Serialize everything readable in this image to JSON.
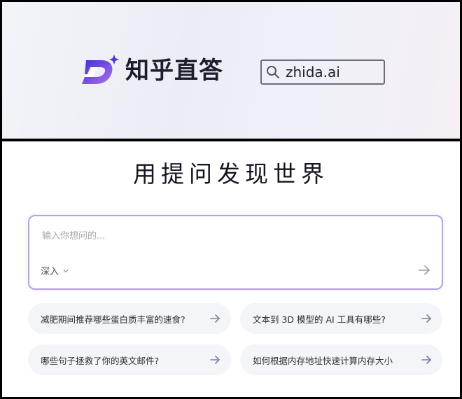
{
  "banner": {
    "brand_name": "知乎直答",
    "domain": "zhida.ai"
  },
  "hero": {
    "title": "用提问发现世界"
  },
  "ask": {
    "placeholder": "输入你想问的...",
    "mode_label": "深入"
  },
  "suggestions": [
    {
      "text": "减肥期间推荐哪些蛋白质丰富的速食?"
    },
    {
      "text": "文本到 3D 模型的 AI 工具有哪些?"
    },
    {
      "text": "哪些句子拯救了你的英文邮件?"
    },
    {
      "text": "如何根据内存地址快速计算内存大小"
    }
  ],
  "icons": {
    "logo": "zhida-logo-icon",
    "sparkle": "sparkle-icon",
    "search": "search-icon",
    "chevron": "chevron-down-icon",
    "send": "arrow-right-icon",
    "suggest_arrow": "arrow-right-icon"
  },
  "colors": {
    "logo_gradient_start": "#3b2fd0",
    "logo_gradient_end": "#b26ef0",
    "ask_border": "#b4a2e3",
    "chip_bg": "#f4f5f8",
    "arrow": "#7b7fa0"
  }
}
